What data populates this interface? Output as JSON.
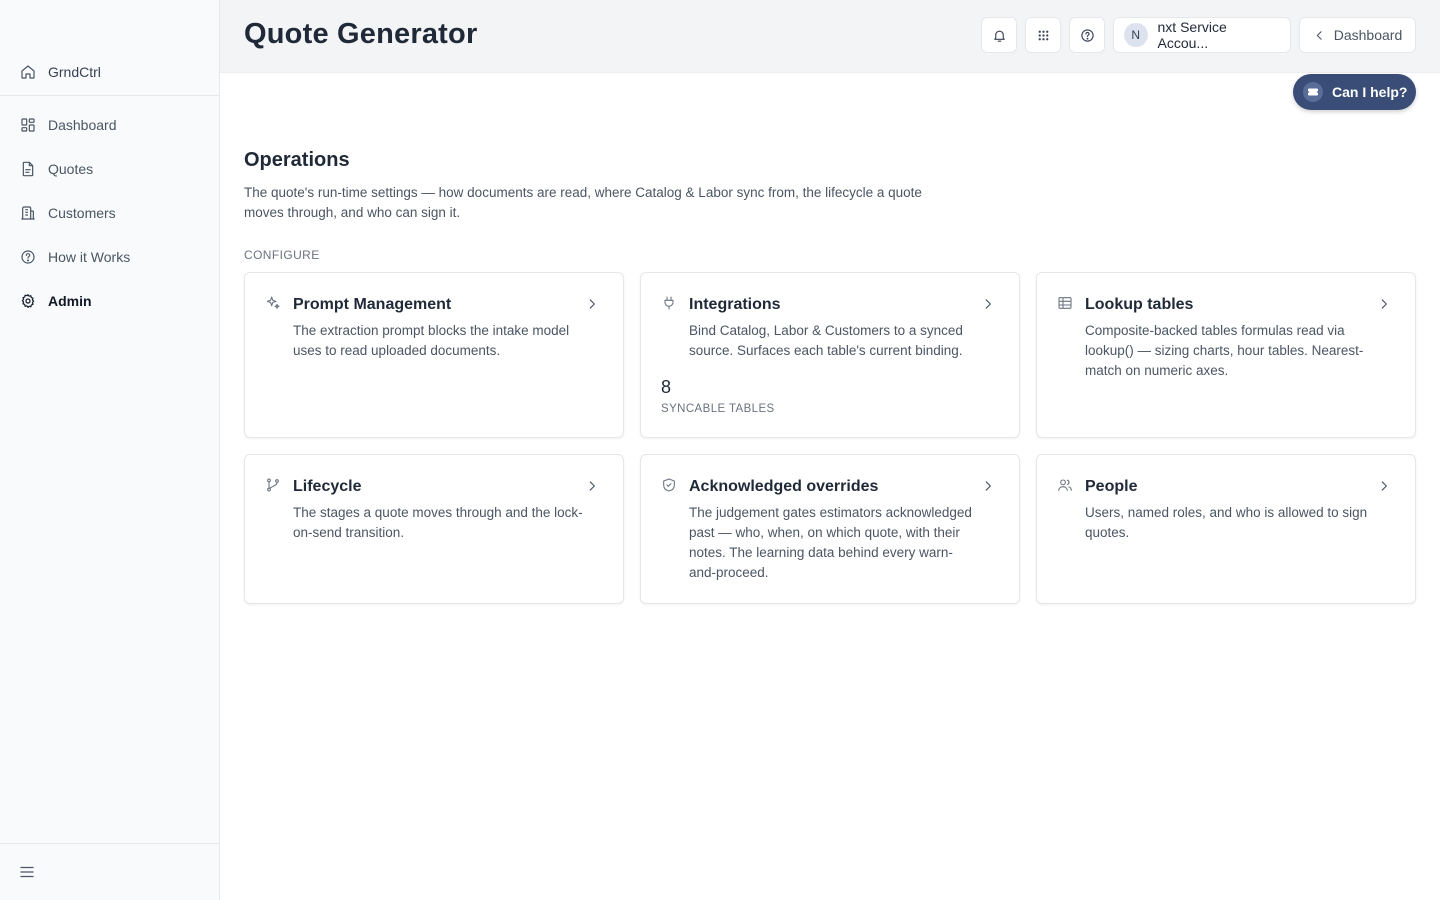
{
  "sidebar": {
    "brand": "GrndCtrl",
    "items": [
      {
        "label": "Dashboard",
        "icon": "dashboard-icon"
      },
      {
        "label": "Quotes",
        "icon": "document-icon"
      },
      {
        "label": "Customers",
        "icon": "building-icon"
      },
      {
        "label": "How it Works",
        "icon": "help-circle-icon"
      },
      {
        "label": "Admin",
        "icon": "gear-icon",
        "active": true
      }
    ]
  },
  "header": {
    "title": "Quote Generator",
    "account_initial": "N",
    "account_name": "nxt Service Accou...",
    "back_label": "Dashboard"
  },
  "help_button": {
    "label": "Can I help?",
    "color": "#3a4d77"
  },
  "section": {
    "title": "Operations",
    "description": "The quote's run-time settings — how documents are read, where Catalog & Labor sync from, the lifecycle a quote moves through, and who can sign it.",
    "group_label": "CONFIGURE"
  },
  "cards": [
    {
      "title": "Prompt Management",
      "description": "The extraction prompt blocks the intake model uses to read uploaded documents.",
      "icon": "sparkle-icon"
    },
    {
      "title": "Integrations",
      "description": "Bind Catalog, Labor & Customers to a synced source. Surfaces each table's current binding.",
      "icon": "plug-icon",
      "stat_value": "8",
      "stat_label": "SYNCABLE TABLES"
    },
    {
      "title": "Lookup tables",
      "description": "Composite-backed tables formulas read via lookup() — sizing charts, hour tables. Nearest-match on numeric axes.",
      "icon": "table-icon"
    },
    {
      "title": "Lifecycle",
      "description": "The stages a quote moves through and the lock-on-send transition.",
      "icon": "branch-icon"
    },
    {
      "title": "Acknowledged overrides",
      "description": "The judgement gates estimators acknowledged past — who, when, on which quote, with their notes. The learning data behind every warn-and-proceed.",
      "icon": "shield-icon"
    },
    {
      "title": "People",
      "description": "Users, named roles, and who is allowed to sign quotes.",
      "icon": "users-icon"
    }
  ]
}
